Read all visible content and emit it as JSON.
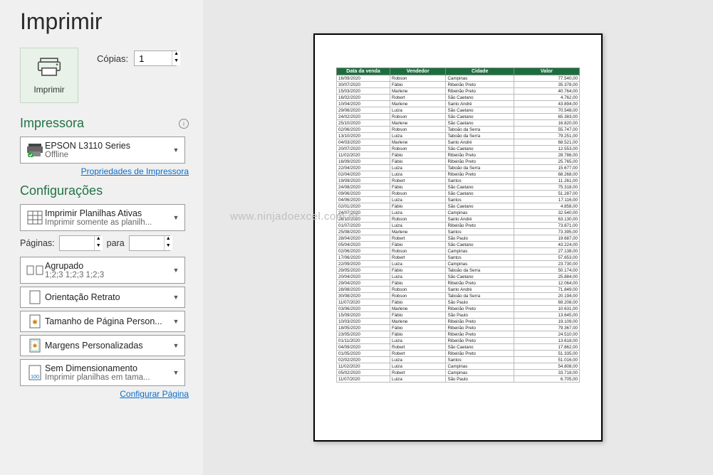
{
  "title": "Imprimir",
  "print_button": "Imprimir",
  "copies_label": "Cópias:",
  "copies_value": "1",
  "printer_section": "Impressora",
  "printer": {
    "name": "EPSON L3110 Series",
    "status": "Offline"
  },
  "printer_props_link": "Propriedades de Impressora",
  "settings_section": "Configurações",
  "settings": {
    "print_what": {
      "line1": "Imprimir Planilhas Ativas",
      "line2": "Imprimir somente as planilh..."
    },
    "pages_label": "Páginas:",
    "pages_to": "para",
    "collation": {
      "line1": "Agrupado",
      "line2": "1;2;3    1;2;3    1;2;3"
    },
    "orientation": {
      "line1": "Orientação Retrato"
    },
    "paper": {
      "line1": "Tamanho de Página Person..."
    },
    "margins": {
      "line1": "Margens Personalizadas"
    },
    "scaling": {
      "line1": "Sem Dimensionamento",
      "line2": "Imprimir planilhas em tama..."
    }
  },
  "page_setup_link": "Configurar Página",
  "watermark": "www.ninjadoexcel.com.br",
  "chart_data": {
    "type": "table",
    "headers": [
      "Data da venda",
      "Vendedor",
      "Cidade",
      "Valor"
    ],
    "rows": [
      [
        "16/09/2020",
        "Robson",
        "Campinas",
        "77.540,00"
      ],
      [
        "30/07/2020",
        "Fábio",
        "Ribeirão Preto",
        "35.378,00"
      ],
      [
        "15/03/2020",
        "Marlene",
        "Ribeirão Preto",
        "40.764,00"
      ],
      [
        "16/02/2020",
        "Robert",
        "São Caetano",
        "4.762,00"
      ],
      [
        "10/04/2020",
        "Marlene",
        "Santo André",
        "43.894,00"
      ],
      [
        "29/06/2020",
        "Luiza",
        "São Caetano",
        "70.548,00"
      ],
      [
        "24/02/2020",
        "Robson",
        "São Caetano",
        "65.383,00"
      ],
      [
        "25/10/2020",
        "Marlene",
        "São Caetano",
        "16.820,00"
      ],
      [
        "02/06/2020",
        "Robson",
        "Taboão da Serra",
        "55.747,00"
      ],
      [
        "13/10/2020",
        "Luiza",
        "Taboão da Serra",
        "79.251,00"
      ],
      [
        "04/03/2020",
        "Marlene",
        "Santo André",
        "68.521,00"
      ],
      [
        "20/07/2020",
        "Robson",
        "São Caetano",
        "12.553,00"
      ],
      [
        "11/02/2020",
        "Fábio",
        "Ribeirão Preto",
        "28.786,00"
      ],
      [
        "16/09/2020",
        "Fábio",
        "Ribeirão Preto",
        "25.765,00"
      ],
      [
        "22/04/2020",
        "Luiza",
        "Taboão da Serra",
        "15.677,00"
      ],
      [
        "02/04/2020",
        "Luiza",
        "Ribeirão Preto",
        "68.268,00"
      ],
      [
        "19/09/2020",
        "Robert",
        "Santos",
        "11.261,00"
      ],
      [
        "24/08/2020",
        "Fábio",
        "São Caetano",
        "75.318,00"
      ],
      [
        "09/06/2020",
        "Robson",
        "São Caetano",
        "51.287,00"
      ],
      [
        "04/06/2020",
        "Luiza",
        "Santos",
        "17.116,00"
      ],
      [
        "02/01/2020",
        "Fábio",
        "São Caetano",
        "4.858,00"
      ],
      [
        "24/07/2020",
        "Luiza",
        "Campinas",
        "32.540,00"
      ],
      [
        "28/10/2020",
        "Robson",
        "Santo André",
        "63.130,00"
      ],
      [
        "01/07/2020",
        "Luiza",
        "Ribeirão Preto",
        "73.871,00"
      ],
      [
        "25/08/2020",
        "Marlene",
        "Santos",
        "73.395,00"
      ],
      [
        "28/04/2020",
        "Robert",
        "São Paulo",
        "19.687,00"
      ],
      [
        "05/04/2020",
        "Fábio",
        "São Caetano",
        "43.224,00"
      ],
      [
        "02/06/2020",
        "Robson",
        "Campinas",
        "27.138,00"
      ],
      [
        "17/06/2020",
        "Robert",
        "Santos",
        "57.653,00"
      ],
      [
        "22/09/2020",
        "Luiza",
        "Campinas",
        "23.730,00"
      ],
      [
        "29/05/2020",
        "Fábio",
        "Taboão da Serra",
        "50.174,00"
      ],
      [
        "20/04/2020",
        "Luiza",
        "São Caetano",
        "25.884,00"
      ],
      [
        "29/04/2020",
        "Fábio",
        "Ribeirão Preto",
        "12.064,00"
      ],
      [
        "28/08/2020",
        "Robson",
        "Santo André",
        "71.849,00"
      ],
      [
        "30/08/2020",
        "Robson",
        "Taboão da Serra",
        "20.194,00"
      ],
      [
        "11/07/2020",
        "Fábio",
        "São Paulo",
        "69.208,00"
      ],
      [
        "03/06/2020",
        "Marlene",
        "Ribeirão Preto",
        "10.631,00"
      ],
      [
        "15/09/2020",
        "Fábio",
        "São Paulo",
        "13.645,00"
      ],
      [
        "10/03/2020",
        "Marlene",
        "Ribeirão Preto",
        "19.109,00"
      ],
      [
        "18/05/2020",
        "Fábio",
        "Ribeirão Preto",
        "79.367,00"
      ],
      [
        "23/05/2020",
        "Fábio",
        "Ribeirão Preto",
        "24.510,00"
      ],
      [
        "01/11/2020",
        "Luiza",
        "Ribeirão Preto",
        "13.618,00"
      ],
      [
        "04/09/2020",
        "Robert",
        "São Caetano",
        "17.862,00"
      ],
      [
        "01/05/2020",
        "Robert",
        "Ribeirão Preto",
        "51.335,00"
      ],
      [
        "02/02/2020",
        "Luiza",
        "Santos",
        "51.016,00"
      ],
      [
        "11/02/2020",
        "Luiza",
        "Campinas",
        "54.808,00"
      ],
      [
        "05/02/2020",
        "Robert",
        "Campinas",
        "33.718,00"
      ],
      [
        "11/07/2020",
        "Luiza",
        "São Paulo",
        "6.705,00"
      ]
    ]
  }
}
